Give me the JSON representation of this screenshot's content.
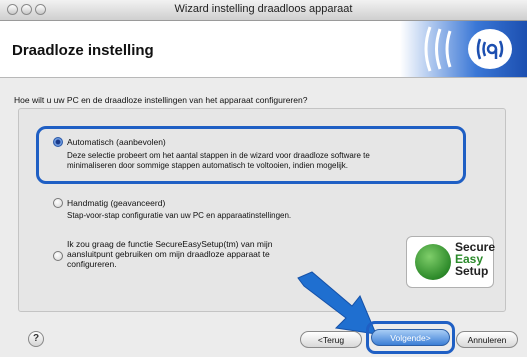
{
  "window": {
    "title": "Wizard instelling draadloos apparaat"
  },
  "header": {
    "title": "Draadloze instelling"
  },
  "question": "Hoe wilt u uw PC en de draadloze instellingen van het apparaat configureren?",
  "options": [
    {
      "label": "Automatisch (aanbevolen)",
      "selected": true,
      "description_lines": [
        "Deze selectie probeert om het aantal stappen in de wizard voor draadloze software te",
        "minimaliseren door sommige stappen automatisch te voltooien, indien mogelijk."
      ]
    },
    {
      "label": "Handmatig (geavanceerd)",
      "selected": false,
      "description_lines": [
        "Stap-voor-stap configuratie van uw PC en apparaatinstellingen."
      ]
    },
    {
      "label_lines": [
        "Ik zou graag de functie SecureEasySetup(tm) van mijn",
        "aansluitpunt gebruiken om mijn draadloze apparaat te",
        "configureren."
      ],
      "selected": false
    }
  ],
  "badge": {
    "line1": "Secure",
    "line2": "Easy",
    "line3": "Setup"
  },
  "buttons": {
    "back": "<Terug",
    "next": "Volgende>",
    "cancel": "Annuleren"
  },
  "help_symbol": "?",
  "colors": {
    "highlight": "#1f5fc4",
    "arrow": "#1f6fd0",
    "badge_green": "#2d8a2a"
  }
}
